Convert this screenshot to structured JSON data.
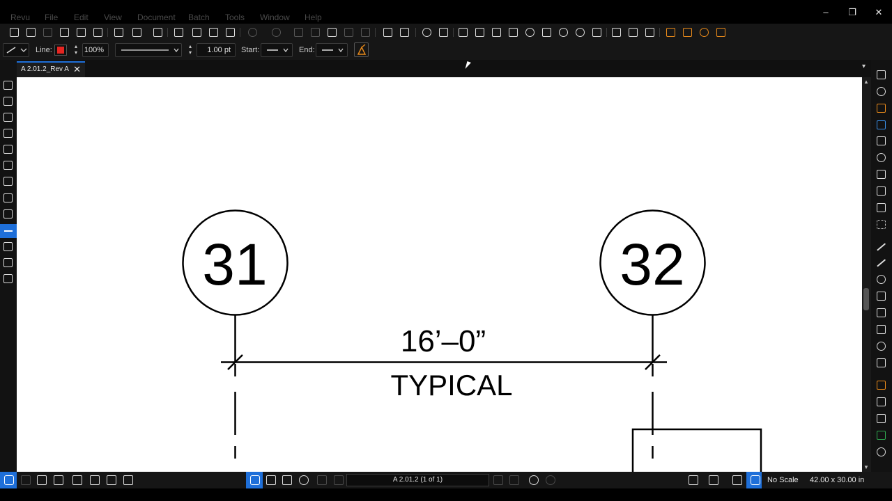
{
  "menubar": {
    "items": [
      "Revu",
      "File",
      "Edit",
      "View",
      "Document",
      "Batch",
      "Tools",
      "Window",
      "Help"
    ]
  },
  "window_controls": {
    "minimize": "–",
    "restore": "❐",
    "close": "✕"
  },
  "properties_bar": {
    "line_label": "Line:",
    "line_color": "#e52521",
    "opacity_value": "100%",
    "line_width_value": "1.00 pt",
    "start_label": "Start:",
    "end_label": "End:"
  },
  "tabs": {
    "active_document": "A 2.01.2_Rev A",
    "close_glyph": "✕"
  },
  "drawing": {
    "grid_left_number": "31",
    "grid_right_number": "32",
    "dimension_text": "16’–0”",
    "dimension_note": "TYPICAL"
  },
  "statusbar": {
    "page_indicator": "A 2.01.2 (1 of 1)",
    "scale": "No Scale",
    "page_size": "42.00 x 30.00 in"
  },
  "colors": {
    "accent": "#1e6fd9",
    "orange": "#e98a1a",
    "green": "#2fa84f"
  }
}
